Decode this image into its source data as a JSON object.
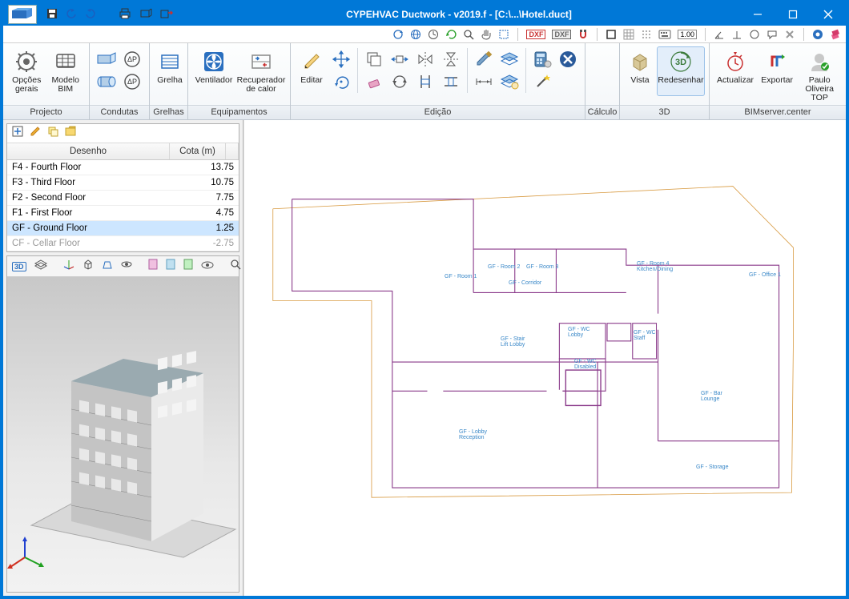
{
  "title": "CYPEHVAC Ductwork - v2019.f - [C:\\...\\Hotel.duct]",
  "ribbon_groups": {
    "projecto": {
      "label": "Projecto",
      "btns": [
        {
          "label": "Opções gerais"
        },
        {
          "label": "Modelo BIM"
        }
      ]
    },
    "condutas": {
      "label": "Condutas"
    },
    "grelhas": {
      "label": "Grelhas",
      "btns": [
        {
          "label": "Grelha"
        }
      ]
    },
    "equip": {
      "label": "Equipamentos",
      "btns": [
        {
          "label": "Ventilador"
        },
        {
          "label": "Recuperador de calor"
        }
      ]
    },
    "edicao": {
      "label": "Edição",
      "btns": [
        {
          "label": "Editar"
        }
      ]
    },
    "calculo": {
      "label": "Cálculo"
    },
    "d3": {
      "label": "3D",
      "btns": [
        {
          "label": "Vista"
        },
        {
          "label": "Redesenhar"
        }
      ]
    },
    "bim": {
      "label": "BIMserver.center",
      "btns": [
        {
          "label": "Actualizar"
        },
        {
          "label": "Exportar"
        },
        {
          "label": "Paulo Oliveira TOP"
        }
      ]
    }
  },
  "table": {
    "headers": {
      "c1": "Desenho",
      "c2": "Cota (m)"
    },
    "rows": [
      {
        "name": "F4 - Fourth Floor",
        "cota": "13.75"
      },
      {
        "name": "F3 - Third Floor",
        "cota": "10.75"
      },
      {
        "name": "F2 - Second Floor",
        "cota": "7.75"
      },
      {
        "name": "F1 - First Floor",
        "cota": "4.75"
      },
      {
        "name": "GF - Ground Floor",
        "cota": "1.25",
        "selected": true
      },
      {
        "name": "CF - Cellar Floor",
        "cota": "-2.75",
        "cut": true
      }
    ]
  }
}
